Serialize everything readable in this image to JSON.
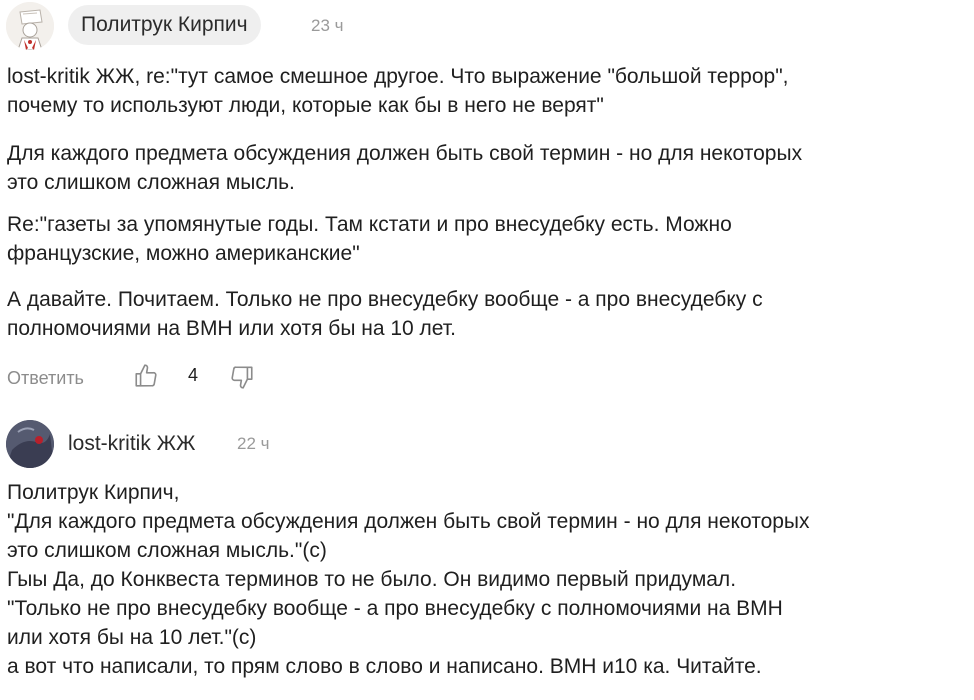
{
  "comments": [
    {
      "author": "Политрук Кирпич",
      "time": "23 ч",
      "paragraphs": [
        [
          "lost-kritik ЖЖ, re:\"тут самое смешное другое. Что выражение \"большой террор\",",
          "почему то используют люди, которые как бы в него не верят\""
        ],
        [
          "Для каждого предмета обсуждения должен быть свой термин - но для некоторых",
          "это слишком сложная мысль."
        ],
        [
          "Re:\"газеты за упомянутые годы. Там кстати и про внесудебку есть. Можно",
          "французские, можно американские\""
        ],
        [
          "А давайте. Почитаем. Только не про внесудебку вообще - а про внесудебку с",
          "полномочиями на ВМН или хотя бы на 10 лет."
        ]
      ],
      "reply_label": "Ответить",
      "likes": "4",
      "like_icon": "thumbs-up-icon",
      "dislike_icon": "thumbs-down-icon"
    },
    {
      "author": "lost-kritik ЖЖ",
      "time": "22 ч",
      "lines": [
        "Политрук Кирпич,",
        "\"Для каждого предмета обсуждения должен быть свой термин - но для некоторых",
        "это слишком сложная мысль.\"(с)",
        "Гыы Да, до Конквеста терминов то не было. Он видимо первый придумал.",
        "\"Только не про внесудебку вообще - а про внесудебку с полномочиями на ВМН",
        "или хотя бы на 10 лет.\"(с)",
        "а вот что написали, то прям слово в слово и написано. ВМН и10 ка. Читайте."
      ]
    }
  ]
}
